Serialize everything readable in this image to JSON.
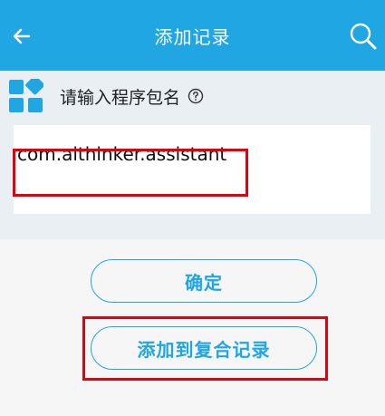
{
  "header": {
    "title": "添加记录",
    "back_icon": "back-arrow-icon",
    "search_icon": "search-icon"
  },
  "form": {
    "icon": "apps-icon",
    "label": "请输入程序包名",
    "help_icon": "help-icon",
    "package_value": "com.aithinker.assistant"
  },
  "buttons": {
    "confirm_label": "确定",
    "add_composite_label": "添加到复合记录"
  },
  "colors": {
    "accent": "#1fa6e3",
    "highlight": "#e6000c",
    "section_bg": "#eaeff4"
  }
}
